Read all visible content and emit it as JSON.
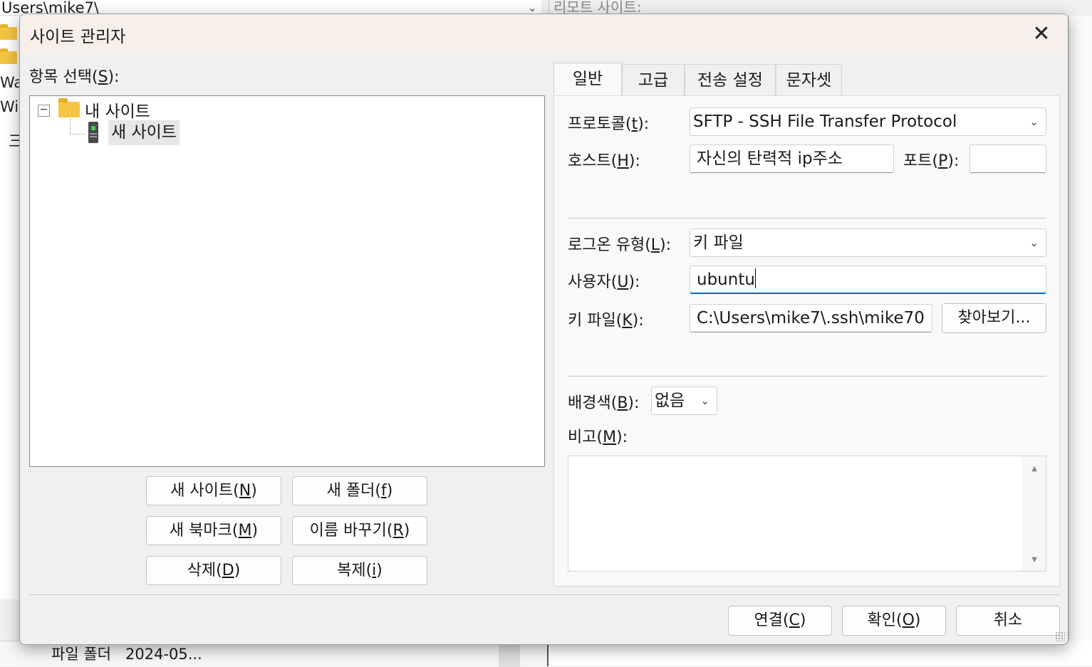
{
  "background": {
    "path": "Users\\mike7\\",
    "remote_label": "리모트 사이트:",
    "frag1": "Wa",
    "frag2": "Wi",
    "frag3": "三",
    "bottom_row": "파일 폴더   2024-05..."
  },
  "dialog": {
    "title": "사이트 관리자",
    "close": "✕"
  },
  "left": {
    "select_label": "항목 선택",
    "select_key": "S",
    "tree": {
      "root": "내 사이트",
      "child": "새 사이트"
    },
    "buttons": {
      "new_site": {
        "text": "새 사이트",
        "key": "N"
      },
      "new_folder": {
        "text": "새 폴더",
        "key": "f"
      },
      "new_bookmark": {
        "text": "새 북마크",
        "key": "M"
      },
      "rename": {
        "text": "이름 바꾸기",
        "key": "R"
      },
      "delete": {
        "text": "삭제",
        "key": "D"
      },
      "duplicate": {
        "text": "복제",
        "key": "i"
      }
    }
  },
  "tabs": [
    "일반",
    "고급",
    "전송 설정",
    "문자셋"
  ],
  "general": {
    "protocol": {
      "label": "프로토콜",
      "key": "t",
      "value": "SFTP - SSH File Transfer Protocol"
    },
    "host": {
      "label": "호스트",
      "key": "H",
      "value": "자신의 탄력적 ip주소"
    },
    "port": {
      "label": "포트",
      "key": "P",
      "value": ""
    },
    "logon": {
      "label": "로그온 유형",
      "key": "L",
      "value": "키 파일"
    },
    "user": {
      "label": "사용자",
      "key": "U",
      "value": "ubuntu"
    },
    "keyfile": {
      "label": "키 파일",
      "key": "K",
      "value": "C:\\Users\\mike7\\.ssh\\mike70",
      "browse": "찾아보기..."
    },
    "bgcolor": {
      "label": "배경색",
      "key": "B",
      "value": "없음"
    },
    "memo": {
      "label": "비고",
      "key": "M",
      "value": ""
    }
  },
  "footer": {
    "connect": {
      "text": "연결",
      "key": "C"
    },
    "ok": {
      "text": "확인",
      "key": "O"
    },
    "cancel": "취소"
  }
}
